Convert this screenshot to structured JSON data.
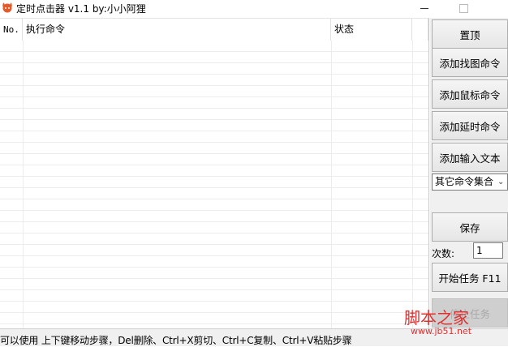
{
  "window": {
    "title": "定时点击器 v1.1 by:小小阿狸"
  },
  "table": {
    "columns": [
      "No.",
      "执行命令",
      "状态"
    ],
    "rows": []
  },
  "sidebar": {
    "top_button": "置顶",
    "add_find_image": "添加找图命令",
    "add_mouse": "添加鼠标命令",
    "add_delay": "添加延时命令",
    "add_text": "添加输入文本",
    "other_select": "其它命令集合",
    "save": "保存",
    "count_label": "次数:",
    "count_value": "1",
    "start": "开始任务 F11",
    "stop": "停止任务"
  },
  "status": {
    "text": "可以使用 上下键移动步骤，Del删除、Ctrl+X剪切、Ctrl+C复制、Ctrl+V粘贴步骤"
  },
  "watermark": {
    "main": "脚本之家",
    "url": "www.jb51.net"
  },
  "colors": {
    "accent": "#e03030",
    "panel": "#f0f0f0"
  }
}
